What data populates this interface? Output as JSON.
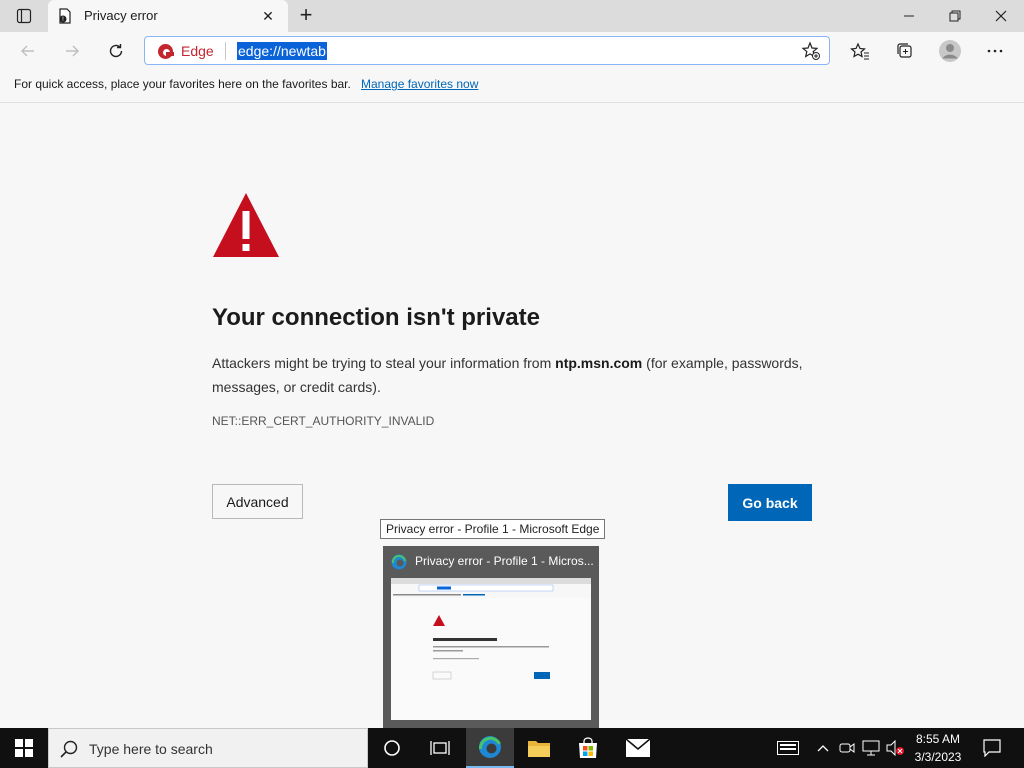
{
  "browser": {
    "tab": {
      "title": "Privacy error",
      "close_glyph": "✕"
    },
    "new_tab_glyph": "+",
    "address": {
      "scheme_label": "Edge",
      "url": "edge://newtab"
    },
    "favorites_bar": {
      "message": "For quick access, place your favorites here on the favorites bar.",
      "link": "Manage favorites now"
    },
    "icons": [
      "tab-actions-icon",
      "back-arrow-icon",
      "forward-arrow-icon",
      "refresh-icon",
      "add-favorite-icon",
      "favorites-icon",
      "collections-icon",
      "profile-avatar-icon",
      "more-menu-icon",
      "minimize-icon",
      "restore-icon",
      "close-icon"
    ]
  },
  "error_page": {
    "heading": "Your connection isn't private",
    "desc_before": "Attackers might be trying to steal your information from ",
    "host": "ntp.msn.com",
    "desc_after": " (for example, passwords, messages, or credit cards).",
    "error_code": "NET::ERR_CERT_AUTHORITY_INVALID",
    "advanced_label": "Advanced",
    "go_back_label": "Go back"
  },
  "taskbar_preview": {
    "tooltip": "Privacy error - Profile 1 - Microsoft Edge",
    "title": "Privacy error - Profile 1 - Micros..."
  },
  "taskbar": {
    "search_placeholder": "Type here to search",
    "clock_time": "8:55 AM",
    "clock_date": "3/3/2023"
  },
  "colors": {
    "accent": "#0067b8",
    "warning_red": "#c50f1f",
    "edge_red": "#c4262e"
  }
}
